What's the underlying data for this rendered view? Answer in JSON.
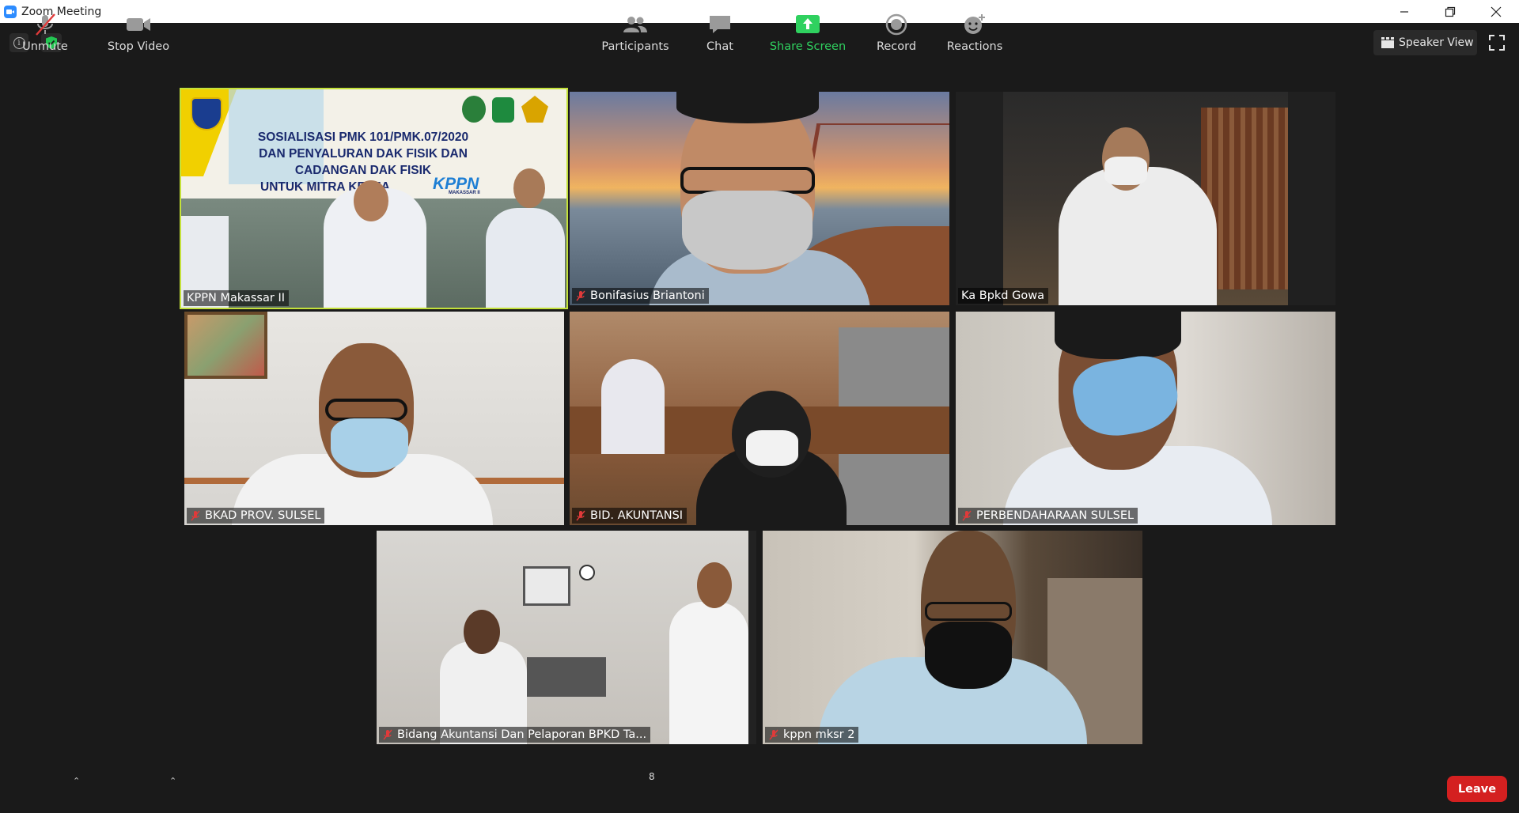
{
  "window": {
    "title": "Zoom Meeting"
  },
  "top_right": {
    "view_label": "Speaker View"
  },
  "participants": [
    {
      "name": "KPPN Makassar II",
      "muted": false,
      "active_speaker": true
    },
    {
      "name": "Bonifasius Briantoni",
      "muted": true,
      "active_speaker": false
    },
    {
      "name": "Ka Bpkd Gowa",
      "muted": false,
      "active_speaker": false
    },
    {
      "name": "BKAD PROV. SULSEL",
      "muted": true,
      "active_speaker": false
    },
    {
      "name": "BID. AKUNTANSI",
      "muted": true,
      "active_speaker": false
    },
    {
      "name": "PERBENDAHARAAN SULSEL",
      "muted": true,
      "active_speaker": false
    },
    {
      "name": "Bidang Akuntansi Dan Pelaporan BPKD Ta...",
      "muted": true,
      "active_speaker": false
    },
    {
      "name": "kppn mksr 2",
      "muted": true,
      "active_speaker": false
    }
  ],
  "banner": {
    "line1": "SOSIALISASI PMK 101/PMK.07/2020",
    "line2": "DAN PENYALURAN DAK FISIK DAN",
    "line3": "CADANGAN DAK FISIK",
    "line4": "UNTUK MITRA KERJA",
    "logo_text": "KPPN",
    "logo_sub": "MAKASSAR II"
  },
  "toolbar": {
    "unmute": "Unmute",
    "stop_video": "Stop Video",
    "participants": "Participants",
    "participants_count": "8",
    "chat": "Chat",
    "share_screen": "Share Screen",
    "record": "Record",
    "reactions": "Reactions",
    "leave": "Leave"
  },
  "colors": {
    "active_border": "#c4e13a",
    "leave": "#d42020",
    "share": "#2fd15f",
    "bg": "#1a1a1a"
  }
}
